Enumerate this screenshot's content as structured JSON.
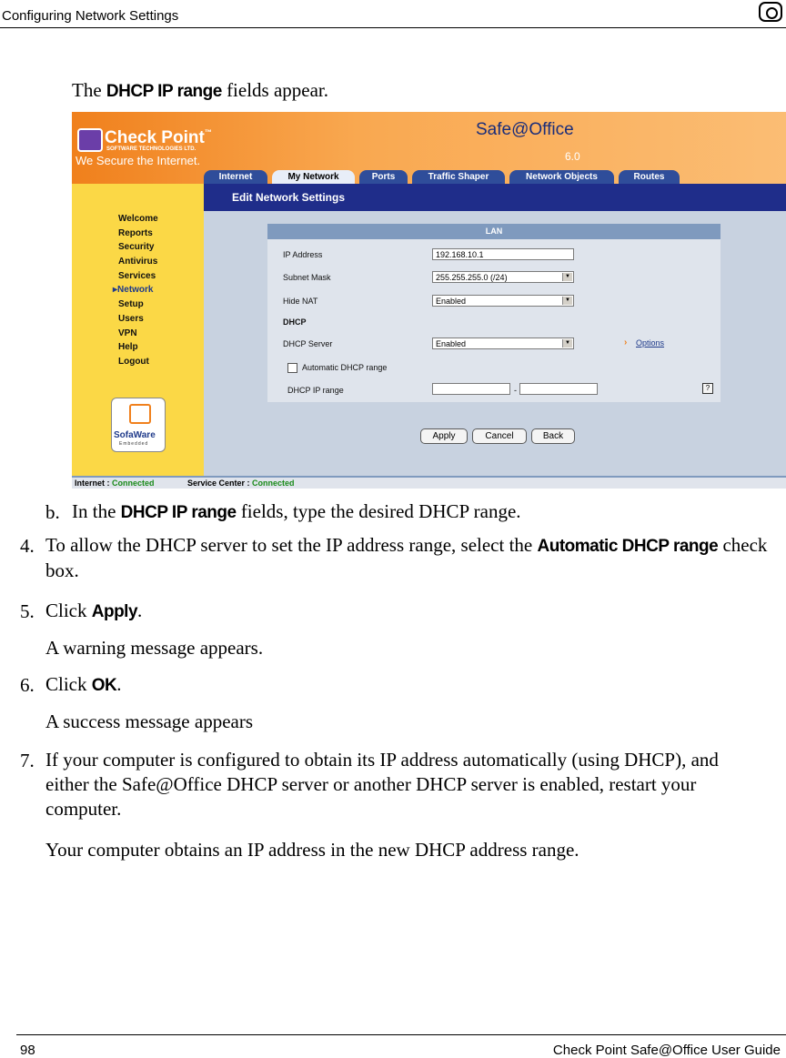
{
  "header": {
    "title": "Configuring Network Settings",
    "icon": "camera-lens-icon"
  },
  "intro": {
    "prefix": "The ",
    "bold": "DHCP IP range",
    "suffix": " fields appear."
  },
  "screenshot": {
    "brand": "Check Point",
    "brand_tm": "™",
    "brand_sub": "SOFTWARE TECHNOLOGIES LTD.",
    "slogan": "We Secure the Internet.",
    "product": "Safe@Office",
    "version": "6.0",
    "tabs": [
      "Internet",
      "My Network",
      "Ports",
      "Traffic Shaper",
      "Network Objects",
      "Routes"
    ],
    "active_tab": "My Network",
    "nav": [
      "Welcome",
      "Reports",
      "Security",
      "Antivirus",
      "Services",
      "Network",
      "Setup",
      "Users",
      "VPN",
      "Help",
      "Logout"
    ],
    "nav_current": "Network",
    "sofa_logo": "SofaWare",
    "sofa_sub": "Embedded",
    "page_heading": "Edit Network Settings",
    "section": "LAN",
    "fields": {
      "ip_label": "IP Address",
      "ip_value": "192.168.10.1",
      "mask_label": "Subnet Mask",
      "mask_value": "255.255.255.0 (/24)",
      "nat_label": "Hide NAT",
      "nat_value": "Enabled",
      "dhcp_heading": "DHCP",
      "dhcp_server_label": "DHCP Server",
      "dhcp_server_value": "Enabled",
      "options_link": "Options",
      "auto_range_label": "Automatic DHCP range",
      "range_label": "DHCP IP range",
      "range_sep": "-"
    },
    "buttons": {
      "apply": "Apply",
      "cancel": "Cancel",
      "back": "Back"
    },
    "status": {
      "internet_label": "Internet : ",
      "internet_value": "Connected",
      "service_label": "Service Center : ",
      "service_value": "Connected"
    }
  },
  "steps": {
    "b_num": "b.",
    "b_prefix": "In the ",
    "b_bold": "DHCP IP range",
    "b_suffix": " fields, type the desired DHCP range.",
    "s4_num": "4.",
    "s4_prefix": "To allow the DHCP server to set the IP address range, select the ",
    "s4_bold": "Automatic DHCP range",
    "s4_suffix": " check box.",
    "s5_num": "5.",
    "s5_prefix": "Click ",
    "s5_bold": "Apply",
    "s5_suffix": ".",
    "s5_note": "A warning message appears.",
    "s6_num": "6.",
    "s6_prefix": "Click ",
    "s6_bold": "OK",
    "s6_suffix": ".",
    "s6_note": "A success message appears",
    "s7_num": "7.",
    "s7_text": "If your computer is configured to obtain its IP address automatically (using DHCP), and either the Safe@Office DHCP server or another DHCP server is enabled, restart your computer.",
    "s7_note": "Your computer obtains an IP address in the new DHCP address range."
  },
  "footer": {
    "page": "98",
    "guide": "Check Point Safe@Office User Guide"
  }
}
